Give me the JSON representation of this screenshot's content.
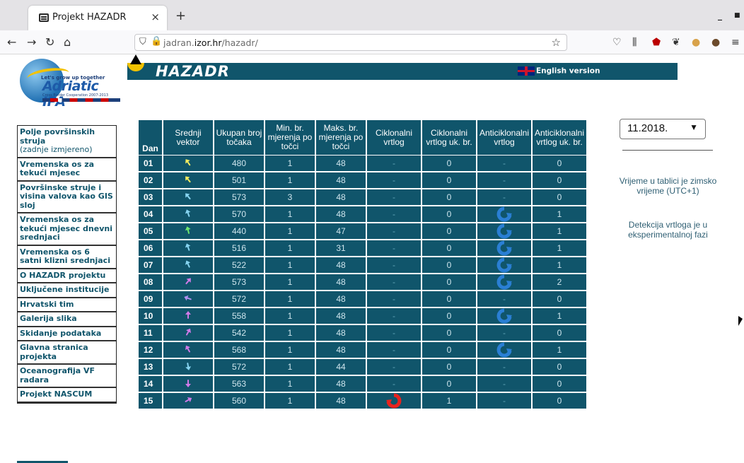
{
  "browser": {
    "tab_title": "Projekt HAZADR",
    "tab_close": "×",
    "new_tab": "+",
    "url_host": "jadran.",
    "url_domain": "izor.hr",
    "url_path": "/hazadr/"
  },
  "header": {
    "logo_tag": "Let's grow up together",
    "logo_name": "Adriatic IPA",
    "logo_sub": "Cross Border Cooperation 2007-2013",
    "brand": "HAZADR",
    "english_link": "English version"
  },
  "sidebar": {
    "items": [
      {
        "label": "Polje površinskih struja",
        "sub": "(zadnje izmjereno)"
      },
      {
        "label": "Vremenska os za tekući mjesec"
      },
      {
        "label": "Površinske struje i visina valova kao GIS sloj"
      },
      {
        "label": "Vremenska os za tekući mjesec dnevni srednjaci"
      },
      {
        "label": "Vremenska os 6 satni klizni srednjaci"
      },
      {
        "label": "O HAZADR projektu"
      },
      {
        "label": "Uključene institucije"
      },
      {
        "label": "Hrvatski tim"
      },
      {
        "label": "Galerija slika"
      },
      {
        "label": "Skidanje podataka"
      },
      {
        "label": "Glavna stranica projekta"
      },
      {
        "label": "Oceanografija VF radara"
      },
      {
        "label": "Projekt NASCUM"
      }
    ]
  },
  "table": {
    "headers": [
      "Dan",
      "Srednji vektor",
      "Ukupan broj točaka",
      "Min. br. mjerenja po točci",
      "Maks. br. mjerenja po točci",
      "Ciklonalni vrtlog",
      "Ciklonalni vrtlog uk. br.",
      "Anticiklonalni vrtlog",
      "Anticiklonalni vrtlog uk. br."
    ],
    "rows": [
      {
        "dan": "01",
        "vec": "#f0ea60",
        "ang": -35,
        "total": "480",
        "min": "1",
        "max": "48",
        "cyc": "-",
        "cyc_n": "0",
        "anti": "-",
        "anti_n": "0"
      },
      {
        "dan": "02",
        "vec": "#f0ea60",
        "ang": -40,
        "total": "501",
        "min": "1",
        "max": "48",
        "cyc": "-",
        "cyc_n": "0",
        "anti": "-",
        "anti_n": "0"
      },
      {
        "dan": "03",
        "vec": "#86d4f0",
        "ang": -40,
        "total": "573",
        "min": "3",
        "max": "48",
        "cyc": "-",
        "cyc_n": "0",
        "anti": "-",
        "anti_n": "0"
      },
      {
        "dan": "04",
        "vec": "#86d4f0",
        "ang": -20,
        "total": "570",
        "min": "1",
        "max": "48",
        "cyc": "-",
        "cyc_n": "0",
        "anti": "vortex",
        "anti_n": "1"
      },
      {
        "dan": "05",
        "vec": "#6fe870",
        "ang": -15,
        "total": "440",
        "min": "1",
        "max": "47",
        "cyc": "-",
        "cyc_n": "0",
        "anti": "vortex",
        "anti_n": "1"
      },
      {
        "dan": "06",
        "vec": "#86d4f0",
        "ang": -20,
        "total": "516",
        "min": "1",
        "max": "31",
        "cyc": "-",
        "cyc_n": "0",
        "anti": "vortex",
        "anti_n": "1"
      },
      {
        "dan": "07",
        "vec": "#86d4f0",
        "ang": -25,
        "total": "522",
        "min": "1",
        "max": "48",
        "cyc": "-",
        "cyc_n": "0",
        "anti": "vortex",
        "anti_n": "1"
      },
      {
        "dan": "08",
        "vec": "#d07ae8",
        "ang": 40,
        "total": "573",
        "min": "1",
        "max": "48",
        "cyc": "-",
        "cyc_n": "0",
        "anti": "vortex",
        "anti_n": "2"
      },
      {
        "dan": "09",
        "vec": "#b090f0",
        "ang": -70,
        "total": "572",
        "min": "1",
        "max": "48",
        "cyc": "-",
        "cyc_n": "0",
        "anti": "-",
        "anti_n": "0"
      },
      {
        "dan": "10",
        "vec": "#d07ae8",
        "ang": 0,
        "total": "558",
        "min": "1",
        "max": "48",
        "cyc": "-",
        "cyc_n": "0",
        "anti": "vortex",
        "anti_n": "1"
      },
      {
        "dan": "11",
        "vec": "#d07ae8",
        "ang": 30,
        "total": "542",
        "min": "1",
        "max": "48",
        "cyc": "-",
        "cyc_n": "0",
        "anti": "-",
        "anti_n": "0"
      },
      {
        "dan": "12",
        "vec": "#d07ae8",
        "ang": -30,
        "total": "568",
        "min": "1",
        "max": "48",
        "cyc": "-",
        "cyc_n": "0",
        "anti": "vortex",
        "anti_n": "1"
      },
      {
        "dan": "13",
        "vec": "#86d4f0",
        "ang": 170,
        "total": "572",
        "min": "1",
        "max": "44",
        "cyc": "-",
        "cyc_n": "0",
        "anti": "-",
        "anti_n": "0"
      },
      {
        "dan": "14",
        "vec": "#d07ae8",
        "ang": 180,
        "total": "563",
        "min": "1",
        "max": "48",
        "cyc": "-",
        "cyc_n": "0",
        "anti": "-",
        "anti_n": "0"
      },
      {
        "dan": "15",
        "vec": "#d07ae8",
        "ang": 60,
        "total": "560",
        "min": "1",
        "max": "48",
        "cyc": "vortex",
        "cyc_n": "1",
        "anti": "-",
        "anti_n": "0"
      }
    ]
  },
  "month_select": {
    "value": "11.2018."
  },
  "notes": {
    "time": "Vrijeme u tablici je zimsko vrijeme (UTC+1)",
    "detection": "Detekcija vrtloga je u eksperimentalnoj fazi"
  },
  "colors": {
    "table_bg": "#10556b",
    "cyclonic": "#e8231f",
    "anticyclonic": "#2a7fd4"
  }
}
